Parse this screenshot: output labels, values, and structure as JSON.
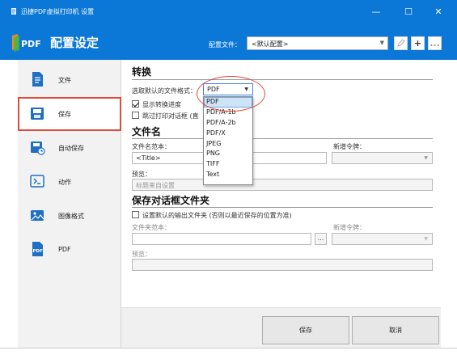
{
  "window": {
    "title": "迅捷PDF虚拟打印机 设置"
  },
  "header": {
    "logo_text": "PDF",
    "title": "配置设定",
    "profile_label": "配置文件：",
    "profile_value": "<默认配置>",
    "buttons": {
      "add": "+",
      "more": "..."
    }
  },
  "sidebar": {
    "items": [
      {
        "label": "文件",
        "icon": "document-icon"
      },
      {
        "label": "保存",
        "icon": "save-icon",
        "active": true
      },
      {
        "label": "自动保存",
        "icon": "autosave-icon"
      },
      {
        "label": "动作",
        "icon": "action-icon"
      },
      {
        "label": "图像格式",
        "icon": "image-format-icon"
      },
      {
        "label": "PDF",
        "icon": "pdf-icon"
      }
    ]
  },
  "convert": {
    "title": "转换",
    "format_label": "选取默认的文件格式：",
    "format_value": "PDF",
    "format_options": [
      "PDF",
      "PDF/A-1b",
      "PDF/A-2b",
      "PDF/X",
      "JPEG",
      "PNG",
      "TIFF",
      "Text"
    ],
    "show_progress_label": "显示转换进度",
    "show_progress_checked": true,
    "skip_dialog_label": "跳过打印对话框 (直",
    "skip_dialog_checked": false
  },
  "filename": {
    "title": "文件名",
    "template_label": "文件名范本：",
    "template_value": "<Title>",
    "new_token_label": "新增令牌：",
    "preview_label": "预览：",
    "preview_value": "标题来自设置"
  },
  "save_dialog": {
    "title": "保存对话框文件夹",
    "default_folder_label": "设置默认的输出文件夹 (否则以最近保存的位置为准)",
    "default_folder_checked": false,
    "folder_template_label": "文件夹范本：",
    "browse_label": "...",
    "new_token_label": "新增令牌：",
    "preview_label": "预览："
  },
  "footer": {
    "save": "保存",
    "cancel": "取消"
  },
  "colors": {
    "accent": "#0b77d6",
    "highlight": "#e04a3c"
  }
}
